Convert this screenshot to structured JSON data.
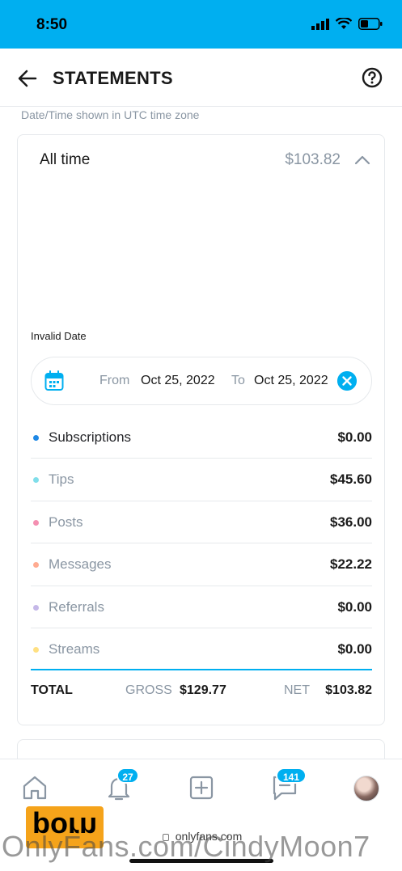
{
  "status_bar": {
    "time": "8:50",
    "bg_color": "#00aff0"
  },
  "header": {
    "title": "STATEMENTS",
    "back_icon": "arrow-left-icon",
    "help_icon": "question-circle-icon"
  },
  "timezone_note": "Date/Time shown in UTC time zone",
  "statement": {
    "period": "All time",
    "total": "$103.82",
    "invalid_date": "Invalid Date",
    "range": {
      "from_label": "From",
      "from_value": "Oct 25, 2022",
      "to_label": "To",
      "to_value": "Oct 25, 2022"
    },
    "rows": [
      {
        "label": "Subscriptions",
        "value": "$0.00",
        "color": "#1e88e5",
        "label_color": "#242529"
      },
      {
        "label": "Tips",
        "value": "$45.60",
        "color": "#80deea",
        "label_color": "#8a96a3"
      },
      {
        "label": "Posts",
        "value": "$36.00",
        "color": "#f48fb1",
        "label_color": "#8a96a3"
      },
      {
        "label": "Messages",
        "value": "$22.22",
        "color": "#ffab91",
        "label_color": "#8a96a3"
      },
      {
        "label": "Referrals",
        "value": "$0.00",
        "color": "#c5b8e8",
        "label_color": "#8a96a3"
      },
      {
        "label": "Streams",
        "value": "$0.00",
        "color": "#ffe082",
        "label_color": "#8a96a3"
      }
    ],
    "totals": {
      "label": "TOTAL",
      "gross_label": "GROSS",
      "gross_value": "$129.77",
      "net_label": "NET",
      "net_value": "$103.82"
    }
  },
  "bottom_nav": {
    "notifications_badge": "27",
    "messages_badge": "141",
    "url": "onlyfans.com"
  },
  "watermark": {
    "logo_text": "porn",
    "text": "OnlyFans.com/CindyMoon7"
  },
  "accent_color": "#00aff0"
}
